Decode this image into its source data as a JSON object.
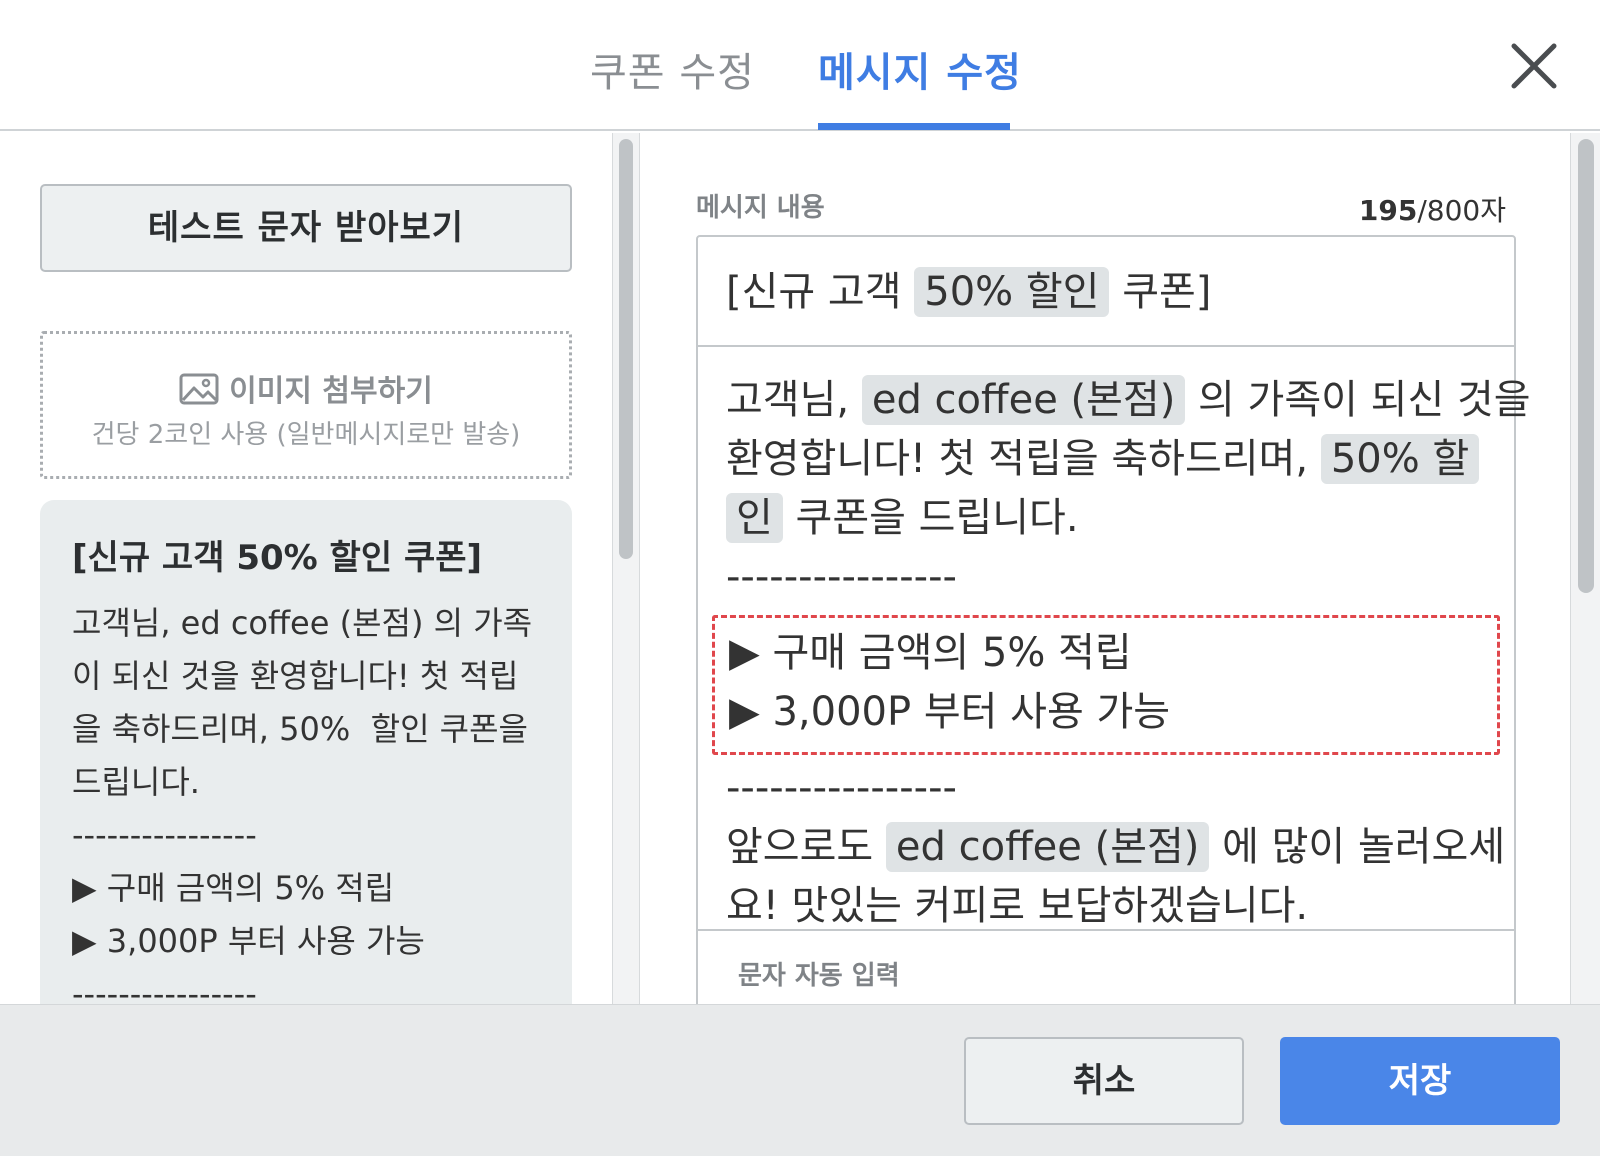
{
  "tabs": {
    "coupon_edit": "쿠폰 수정",
    "message_edit": "메시지 수정",
    "active": "message_edit"
  },
  "left": {
    "test_button": "테스트 문자 받아보기",
    "attach_title": "이미지 첨부하기",
    "attach_sub": "건당 2코인 사용 (일반메시지로만 발송)",
    "preview_title": "[신규 고객 50%  할인 쿠폰]",
    "preview_body": "고객님, ed coffee (본점) 의 가족이 되신 것을 환영합니다! 첫 적립을 축하드리며, 50%  할인 쿠폰을 드립니다.\n----------------\n▶ 구매 금액의 5% 적립\n▶ 3,000P 부터 사용 가능\n----------------"
  },
  "message": {
    "label": "메시지 내용",
    "count_current": "195",
    "count_rest": "/800자",
    "title_prefix": "[신규 고객 ",
    "title_chip": "50% 할인",
    "title_suffix": " 쿠폰]",
    "line1_prefix": "고객님, ",
    "store_chip": "ed coffee (본점)",
    "line1_suffix": " 의 가족이 되신 것을",
    "line2_prefix": "환영합니다! 첫 적립을 축하드리며, ",
    "discount_chip_a": "50% 할",
    "discount_chip_b": "인",
    "line3_suffix": " 쿠폰을 드립니다.",
    "dashes": "----------------",
    "bullet1": "▶ 구매 금액의 5% 적립",
    "bullet2": "▶ 3,000P 부터 사용 가능",
    "line4_prefix": "앞으로도 ",
    "line4_suffix": " 에 많이 놀러오세",
    "line5": "요! 맛있는 커피로 보답하겠습니다.",
    "auto_label": "문자 자동 입력"
  },
  "footer": {
    "cancel": "취소",
    "save": "저장"
  },
  "colors": {
    "accent": "#3f7de3",
    "save_button": "#4a86e8",
    "highlight_border": "#e0474c"
  }
}
